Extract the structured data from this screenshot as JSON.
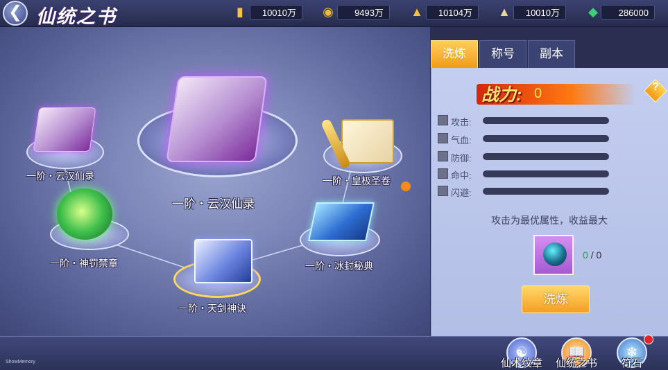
{
  "header": {
    "back_icon": "chevron-left-icon",
    "title": "仙统之书",
    "resources": [
      {
        "icon": "gold-bar-icon",
        "value": "10010万"
      },
      {
        "icon": "coin-icon",
        "value": "9493万"
      },
      {
        "icon": "gold-ingot-icon",
        "value": "10104万"
      },
      {
        "icon": "silver-ingot-icon",
        "value": "10010万"
      },
      {
        "icon": "jade-icon",
        "value": "286000"
      }
    ]
  },
  "books": [
    {
      "label": "一阶・云汉仙录",
      "selected": true
    },
    {
      "label": "一阶・云汉仙录"
    },
    {
      "label": "一阶・皇极圣卷"
    },
    {
      "label": "一阶・神罚禁章"
    },
    {
      "label": "一阶・冰封秘典"
    },
    {
      "label": "一阶・天剑神诀"
    }
  ],
  "panel": {
    "tabs": [
      "洗炼",
      "称号",
      "副本"
    ],
    "active_tab": 0,
    "power_label": "战力:",
    "power_value": "0",
    "stats": [
      "攻击:",
      "气血:",
      "防御:",
      "命中:",
      "闪避:"
    ],
    "hint": "攻击为最优属性，收益最大",
    "gem_current": "0",
    "gem_sep": "/",
    "gem_total": "0",
    "refine_button": "洗炼"
  },
  "bottom_nav": [
    {
      "label": "仙术纹章",
      "icon": "emblem-icon"
    },
    {
      "label": "仙统之书",
      "icon": "book-icon"
    },
    {
      "label": "符石",
      "icon": "rune-stone-icon",
      "badge": true
    }
  ],
  "watermark": "ShowMemory",
  "colors": {
    "accent": "#f5a021",
    "power": "#ffe44c",
    "panel": "#bfc9ee",
    "badge": "#e6242b"
  }
}
